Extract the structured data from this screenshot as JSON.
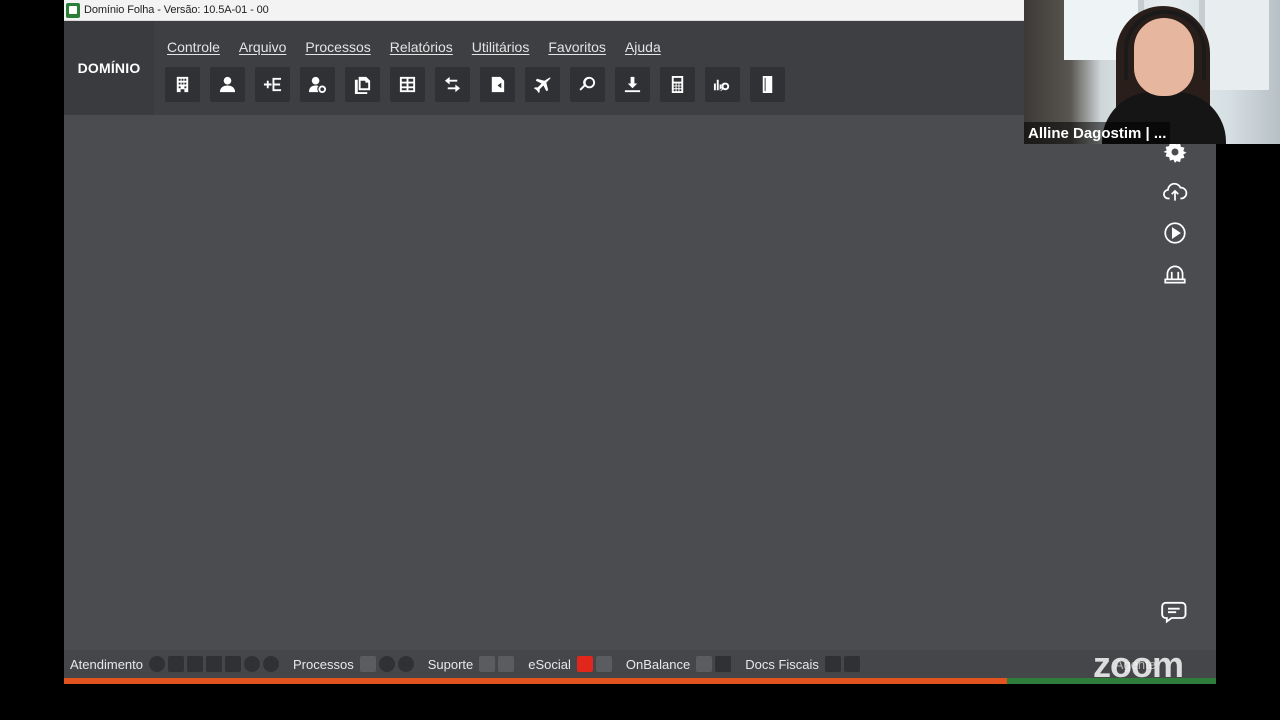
{
  "window": {
    "title": "Domínio Folha - Versão: 10.5A-01 - 00",
    "icon": "app-icon"
  },
  "header": {
    "logo_text": "DOMÍNIO",
    "menu": [
      {
        "label": "Controle"
      },
      {
        "label": "Arquivo"
      },
      {
        "label": "Processos"
      },
      {
        "label": "Relatórios"
      },
      {
        "label": "Utilitários"
      },
      {
        "label": "Favoritos"
      },
      {
        "label": "Ajuda"
      }
    ],
    "toolbar_icons": [
      "building-icon",
      "person-icon",
      "add-entry-icon",
      "user-settings-icon",
      "document-copy-icon",
      "spreadsheet-icon",
      "transfer-icon",
      "document-exchange-icon",
      "airplane-icon",
      "search-icon",
      "download-icon",
      "calculator-icon",
      "chart-search-icon",
      "exit-door-icon"
    ]
  },
  "right_rail": {
    "icons": [
      "gear-icon",
      "cloud-upload-icon",
      "play-circle-icon",
      "helmet-icon"
    ],
    "chat_icon": "chat-bubble-icon"
  },
  "statusbar": {
    "groups": [
      {
        "label": "Atendimento",
        "icons": [
          "play-icon",
          "chat-icon",
          "list-icon",
          "user-icon",
          "ticket-icon",
          "circle-icon",
          "circle-icon"
        ]
      },
      {
        "label": "Processos",
        "icons": [
          "checkbox-icon",
          "circle-icon",
          "circle-icon"
        ]
      },
      {
        "label": "Suporte",
        "icons": [
          "plus-icon",
          "doc-icon"
        ]
      },
      {
        "label": "eSocial",
        "icons": [
          "alert-icon",
          "doc-icon"
        ]
      },
      {
        "label": "OnBalance",
        "icons": [
          "mail-icon",
          "download-icon"
        ]
      },
      {
        "label": "Docs Fiscais",
        "icons": [
          "camera-icon",
          "gallery-icon"
        ]
      }
    ],
    "agent_label": "Agente"
  },
  "progress": {
    "fraction": 0.819,
    "fill_color": "#e2531f",
    "track_color": "#2e7d3b"
  },
  "video": {
    "participant_name": "Alline Dagostim | ..."
  },
  "overlay": {
    "zoom_watermark": "zoom"
  },
  "colors": {
    "background": "#4a4c50",
    "header": "#3d3f43",
    "button": "#2f3134",
    "alert": "#e1261c"
  }
}
